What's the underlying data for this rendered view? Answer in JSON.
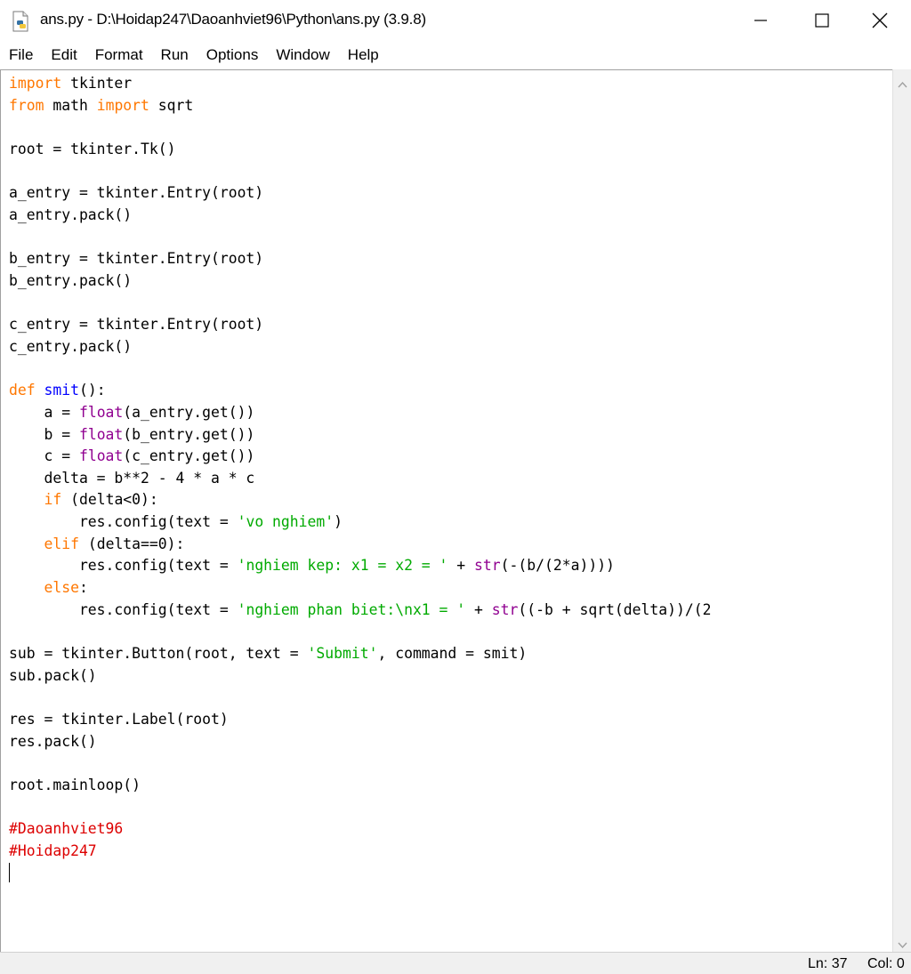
{
  "window": {
    "title": "ans.py - D:\\Hoidap247\\Daoanhviet96\\Python\\ans.py (3.9.8)",
    "app_icon": "python-file-icon",
    "controls": {
      "minimize": "minimize-icon",
      "maximize": "maximize-icon",
      "close": "close-icon"
    }
  },
  "menu": [
    "File",
    "Edit",
    "Format",
    "Run",
    "Options",
    "Window",
    "Help"
  ],
  "editor": {
    "lines": [
      [
        {
          "t": "import",
          "c": "kw"
        },
        {
          "t": " tkinter",
          "c": ""
        }
      ],
      [
        {
          "t": "from",
          "c": "kw"
        },
        {
          "t": " math ",
          "c": ""
        },
        {
          "t": "import",
          "c": "kw"
        },
        {
          "t": " sqrt",
          "c": ""
        }
      ],
      [],
      [
        {
          "t": "root = tkinter.Tk()",
          "c": ""
        }
      ],
      [],
      [
        {
          "t": "a_entry = tkinter.Entry(root)",
          "c": ""
        }
      ],
      [
        {
          "t": "a_entry.pack()",
          "c": ""
        }
      ],
      [],
      [
        {
          "t": "b_entry = tkinter.Entry(root)",
          "c": ""
        }
      ],
      [
        {
          "t": "b_entry.pack()",
          "c": ""
        }
      ],
      [],
      [
        {
          "t": "c_entry = tkinter.Entry(root)",
          "c": ""
        }
      ],
      [
        {
          "t": "c_entry.pack()",
          "c": ""
        }
      ],
      [],
      [
        {
          "t": "def",
          "c": "kw"
        },
        {
          "t": " ",
          "c": ""
        },
        {
          "t": "smit",
          "c": "fn"
        },
        {
          "t": "():",
          "c": ""
        }
      ],
      [
        {
          "t": "    a = ",
          "c": ""
        },
        {
          "t": "float",
          "c": "bi"
        },
        {
          "t": "(a_entry.get())",
          "c": ""
        }
      ],
      [
        {
          "t": "    b = ",
          "c": ""
        },
        {
          "t": "float",
          "c": "bi"
        },
        {
          "t": "(b_entry.get())",
          "c": ""
        }
      ],
      [
        {
          "t": "    c = ",
          "c": ""
        },
        {
          "t": "float",
          "c": "bi"
        },
        {
          "t": "(c_entry.get())",
          "c": ""
        }
      ],
      [
        {
          "t": "    delta = b**2 - 4 * a * c",
          "c": ""
        }
      ],
      [
        {
          "t": "    ",
          "c": ""
        },
        {
          "t": "if",
          "c": "kw"
        },
        {
          "t": " (delta<0):",
          "c": ""
        }
      ],
      [
        {
          "t": "        res.config(text = ",
          "c": ""
        },
        {
          "t": "'vo nghiem'",
          "c": "st"
        },
        {
          "t": ")",
          "c": ""
        }
      ],
      [
        {
          "t": "    ",
          "c": ""
        },
        {
          "t": "elif",
          "c": "kw"
        },
        {
          "t": " (delta==0):",
          "c": ""
        }
      ],
      [
        {
          "t": "        res.config(text = ",
          "c": ""
        },
        {
          "t": "'nghiem kep: x1 = x2 = '",
          "c": "st"
        },
        {
          "t": " + ",
          "c": ""
        },
        {
          "t": "str",
          "c": "bi"
        },
        {
          "t": "(-(b/(2*a))))",
          "c": ""
        }
      ],
      [
        {
          "t": "    ",
          "c": ""
        },
        {
          "t": "else",
          "c": "kw"
        },
        {
          "t": ":",
          "c": ""
        }
      ],
      [
        {
          "t": "        res.config(text = ",
          "c": ""
        },
        {
          "t": "'nghiem phan biet:\\nx1 = '",
          "c": "st"
        },
        {
          "t": " + ",
          "c": ""
        },
        {
          "t": "str",
          "c": "bi"
        },
        {
          "t": "((-b + sqrt(delta))/(2",
          "c": ""
        }
      ],
      [],
      [
        {
          "t": "sub = tkinter.Button(root, text = ",
          "c": ""
        },
        {
          "t": "'Submit'",
          "c": "st"
        },
        {
          "t": ", command = smit)",
          "c": ""
        }
      ],
      [
        {
          "t": "sub.pack()",
          "c": ""
        }
      ],
      [],
      [
        {
          "t": "res = tkinter.Label(root)",
          "c": ""
        }
      ],
      [
        {
          "t": "res.pack()",
          "c": ""
        }
      ],
      [],
      [
        {
          "t": "root.mainloop()",
          "c": ""
        }
      ],
      [],
      [
        {
          "t": "#Daoanhviet96",
          "c": "cm"
        }
      ],
      [
        {
          "t": "#Hoidap247",
          "c": "cm"
        }
      ],
      []
    ],
    "caret_line": 36
  },
  "status": {
    "ln": "Ln: 37",
    "col": "Col: 0"
  },
  "colors": {
    "keyword": "#ff7700",
    "builtin": "#900090",
    "definition": "#0000ff",
    "string": "#00aa00",
    "comment": "#dd0000"
  }
}
